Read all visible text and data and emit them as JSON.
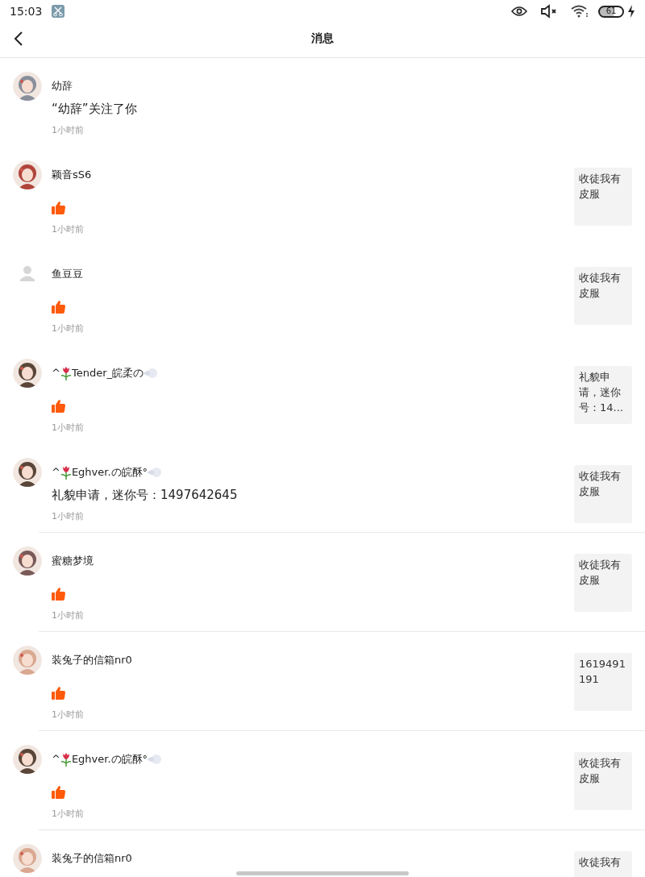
{
  "status_bar": {
    "time": "15:03",
    "battery": "61"
  },
  "header": {
    "title": "消息"
  },
  "messages": [
    {
      "name": "幼辞",
      "decorated": false,
      "content": {
        "kind": "text",
        "text": "“幼辞”关注了你"
      },
      "time": "1小时前",
      "divider": false
    },
    {
      "name": "颖音sS6",
      "decorated": false,
      "content": {
        "kind": "like"
      },
      "time": "1小时前",
      "preview": "收徒我有皮服",
      "divider": false
    },
    {
      "avatar": {
        "kind": "default"
      },
      "name": "鱼豆豆",
      "decorated": false,
      "content": {
        "kind": "like"
      },
      "time": "1小时前",
      "preview": "收徒我有皮服",
      "divider": false
    },
    {
      "prefix": "^",
      "name": "Tender_皖柔の",
      "decorated": true,
      "content": {
        "kind": "like"
      },
      "time": "1小时前",
      "preview": "礼貌申请，迷你号：14...",
      "divider": false
    },
    {
      "prefix": "^",
      "name": "Eghver.の皖酥°",
      "decorated": true,
      "content": {
        "kind": "text",
        "text": "礼貌申请，迷你号：1497642645"
      },
      "time": "1小时前",
      "preview": "收徒我有皮服",
      "divider": true
    },
    {
      "name": "蜜糖梦境",
      "decorated": false,
      "content": {
        "kind": "like"
      },
      "time": "1小时前",
      "preview": "收徒我有皮服",
      "divider": true
    },
    {
      "name": "装兔子的信箱nr0",
      "decorated": false,
      "content": {
        "kind": "like"
      },
      "time": "1小时前",
      "preview": "1619491191",
      "divider": true
    },
    {
      "prefix": "^",
      "name": "Eghver.の皖酥°",
      "decorated": true,
      "content": {
        "kind": "like"
      },
      "time": "1小时前",
      "preview": "收徒我有皮服",
      "divider": true
    },
    {
      "name": "装兔子的信箱nr0",
      "decorated": false,
      "preview": "收徒我有"
    }
  ]
}
